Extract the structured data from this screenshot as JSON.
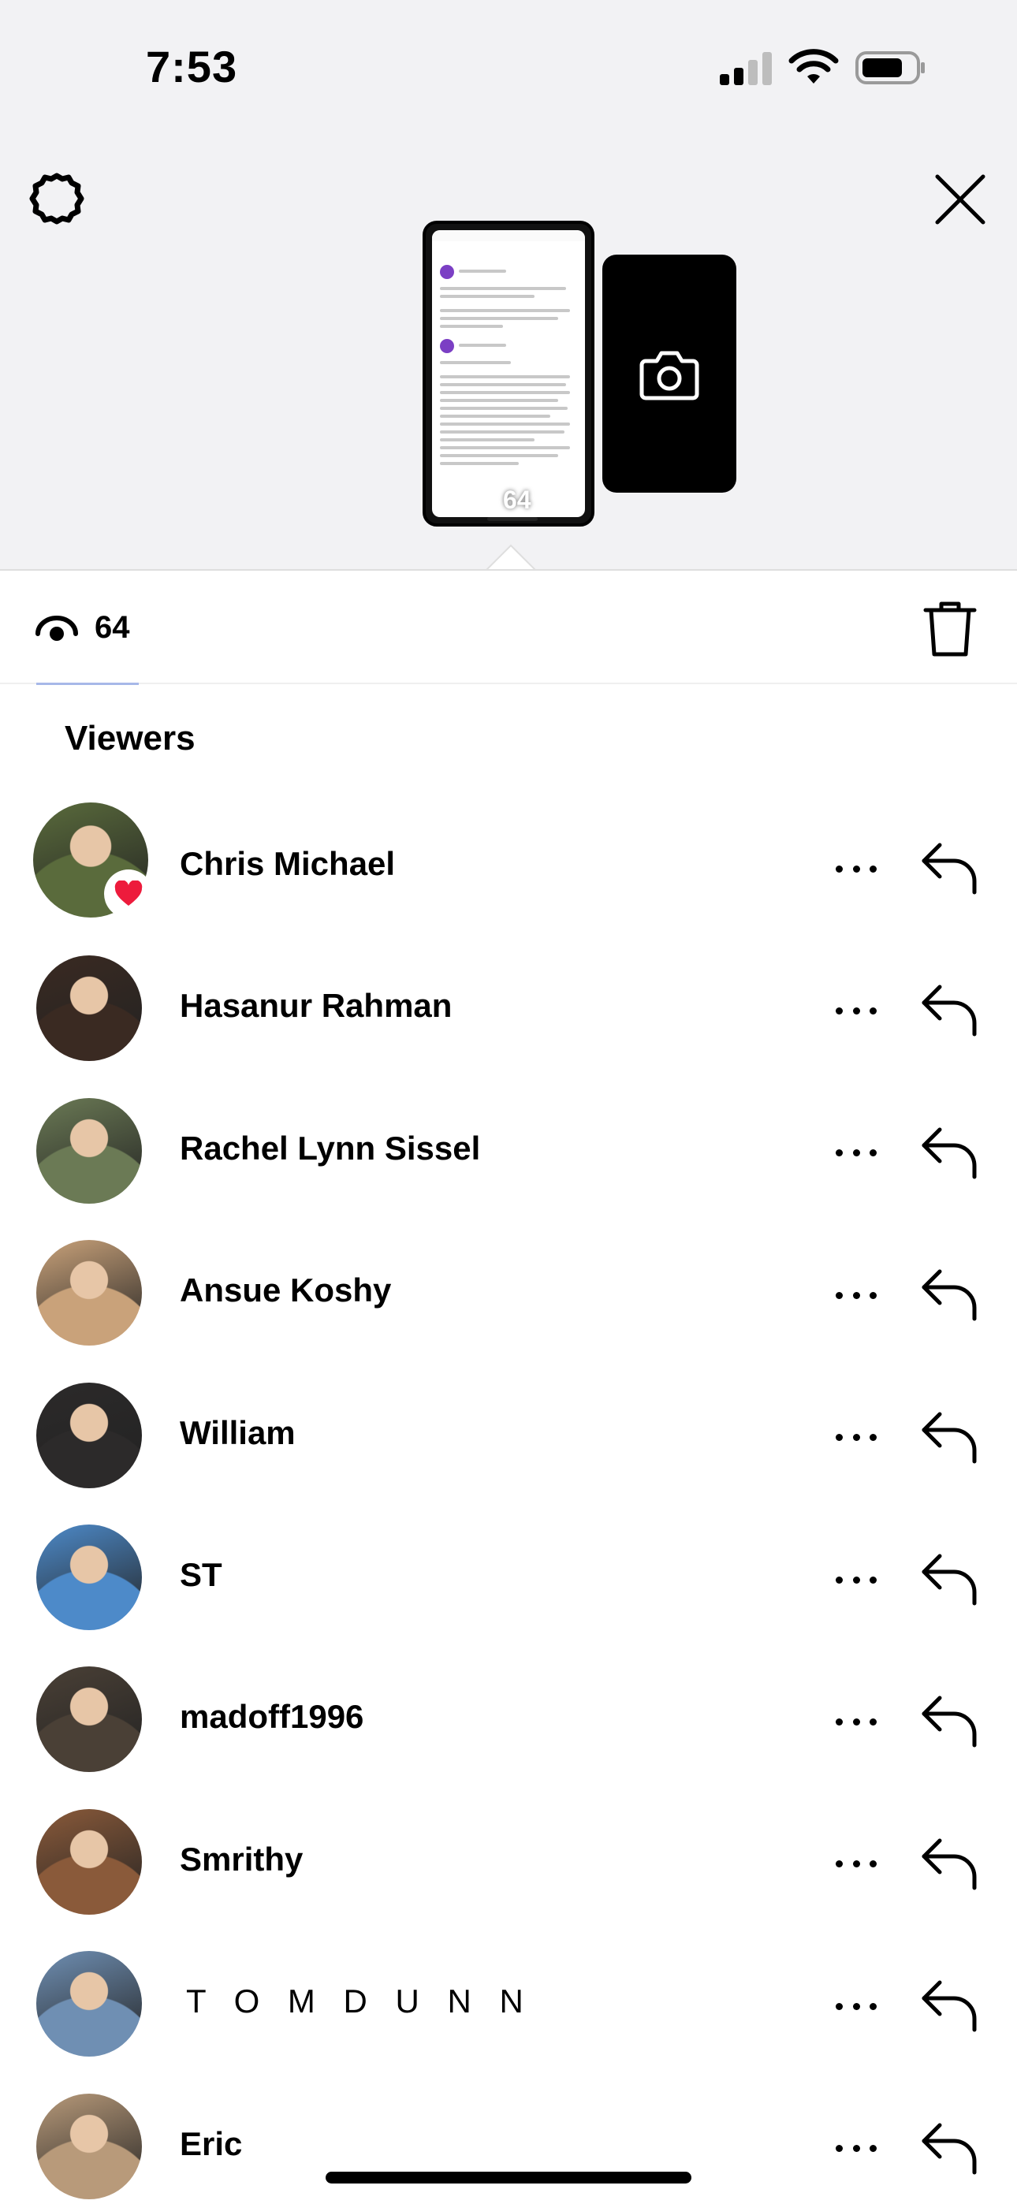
{
  "status_bar": {
    "time": "7:53",
    "signal_icon": "cellular-signal-icon",
    "wifi_icon": "wifi-icon",
    "battery_icon": "battery-icon"
  },
  "header": {
    "settings_icon": "gear-icon",
    "close_icon": "close-icon"
  },
  "story": {
    "view_count": "64",
    "camera_icon": "camera-icon"
  },
  "views_bar": {
    "eye_icon": "eye-icon",
    "count": "64",
    "delete_icon": "trash-icon"
  },
  "viewers": {
    "heading": "Viewers",
    "items": [
      {
        "name": "Chris Michael",
        "liked": true,
        "avatar_color": "#5a6b3c"
      },
      {
        "name": "Hasanur Rahman",
        "liked": false,
        "avatar_color": "#3a2a22"
      },
      {
        "name": "Rachel Lynn Sissel",
        "liked": false,
        "avatar_color": "#6b7a55"
      },
      {
        "name": "Ansue Koshy",
        "liked": false,
        "avatar_color": "#c9a27a"
      },
      {
        "name": "William",
        "liked": false,
        "avatar_color": "#2c2a2a"
      },
      {
        "name": "ST",
        "liked": false,
        "avatar_color": "#4d8ac9"
      },
      {
        "name": "madoff1996",
        "liked": false,
        "avatar_color": "#4a4036"
      },
      {
        "name": "Smrithy",
        "liked": false,
        "avatar_color": "#8a5a3a"
      },
      {
        "name": "T O M D U N N",
        "liked": false,
        "avatar_color": "#6f8fb3"
      },
      {
        "name": "Eric",
        "liked": false,
        "avatar_color": "#b89a7a"
      }
    ]
  },
  "colors": {
    "background_top": "#f2f2f4",
    "heart": "#ed1b3c",
    "text": "#000000"
  }
}
